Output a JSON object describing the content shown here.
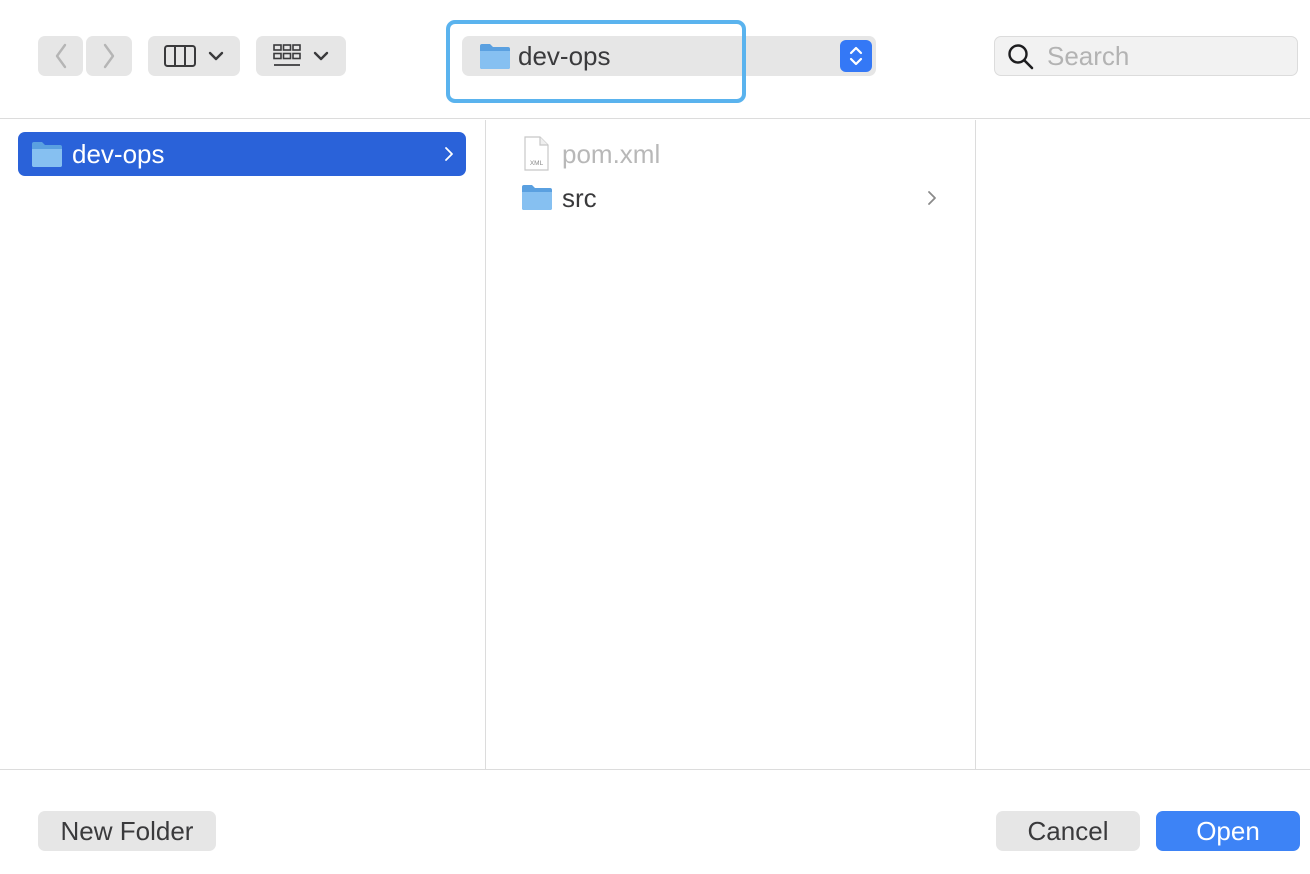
{
  "toolbar": {
    "back_icon": "chevron-left-icon",
    "forward_icon": "chevron-right-icon",
    "column_view_icon": "columns-icon",
    "group_view_icon": "grid-icon",
    "path_label": "dev-ops",
    "search_placeholder": "Search"
  },
  "columns": [
    {
      "items": [
        {
          "name": "dev-ops",
          "type": "folder",
          "selected": true
        }
      ]
    },
    {
      "items": [
        {
          "name": "pom.xml",
          "type": "file",
          "badge": "XML",
          "disabled": true
        },
        {
          "name": "src",
          "type": "folder"
        }
      ]
    },
    {
      "items": []
    }
  ],
  "footer": {
    "new_folder_label": "New Folder",
    "cancel_label": "Cancel",
    "open_label": "Open"
  },
  "colors": {
    "accent": "#3d83f6",
    "selection": "#2a62d9",
    "focus_ring": "#5ab3ee",
    "folder": "#7db8ee"
  }
}
